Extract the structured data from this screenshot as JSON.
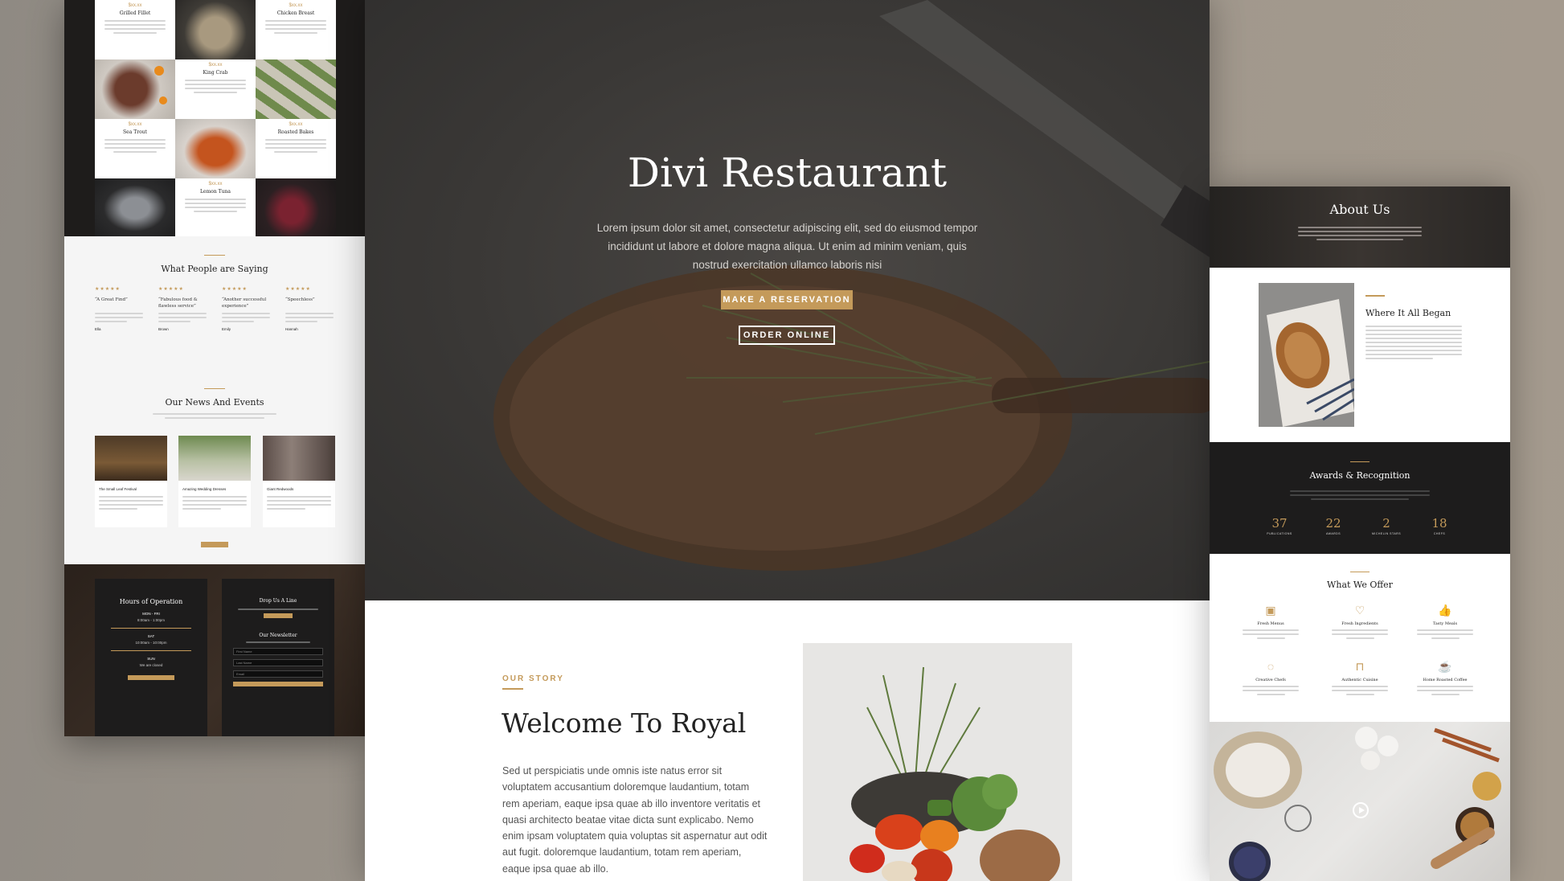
{
  "left_preview": {
    "menu": {
      "items": [
        {
          "price": "$xx.xx",
          "name": "Grilled Fillet"
        },
        {
          "price": "$xx.xx",
          "name": "Chicken Breast"
        },
        {
          "price": "$xx.xx",
          "name": "King Crab"
        },
        {
          "price": "$xx.xx",
          "name": "Sea Trout"
        },
        {
          "price": "$xx.xx",
          "name": "Roasted Bakes"
        },
        {
          "price": "$xx.xx",
          "name": "Lemon Tuna"
        }
      ]
    },
    "testimonials": {
      "title": "What People are Saying",
      "items": [
        {
          "stars": "★★★★★",
          "quote": "“A Great Find”",
          "author": "Ella"
        },
        {
          "stars": "★★★★★",
          "quote": "“Fabulous food & flawless service”",
          "author": "Brown"
        },
        {
          "stars": "★★★★★",
          "quote": "“Another successful experience”",
          "author": "Emily"
        },
        {
          "stars": "★★★★★",
          "quote": "“Speechless”",
          "author": "Hannah"
        }
      ]
    },
    "news": {
      "title": "Our News And Events",
      "items": [
        {
          "title": "The Small Leaf Festival"
        },
        {
          "title": "Amazing Wedding Dresses"
        },
        {
          "title": "Giant Redwoods"
        }
      ]
    },
    "hours": {
      "title": "Hours of Operation",
      "rows": [
        {
          "day": "MON - FRI",
          "time": "8:00am - 1:00pm"
        },
        {
          "day": "SAT",
          "time": "10:00am - 10:00pm"
        },
        {
          "day": "SUN",
          "time": "We are closed"
        }
      ]
    },
    "contact": {
      "title": "Drop Us A Line",
      "newsletter": "Our Newsletter",
      "fields": [
        "First Name",
        "Last Name",
        "Email"
      ]
    }
  },
  "hero": {
    "title": "Divi Restaurant",
    "text": "Lorem ipsum dolor sit amet, consectetur adipiscing elit, sed do eiusmod tempor incididunt ut labore et dolore magna aliqua. Ut enim ad minim veniam, quis nostrud exercitation ullamco laboris nisi",
    "reserve_label": "MAKE A RESERVATION",
    "order_label": "ORDER ONLINE"
  },
  "story": {
    "label": "OUR STORY",
    "title": "Welcome To Royal",
    "text": "Sed ut perspiciatis unde omnis iste natus error sit voluptatem accusantium doloremque laudantium, totam rem aperiam, eaque ipsa quae ab illo inventore veritatis et quasi architecto beatae vitae dicta sunt explicabo. Nemo enim ipsam voluptatem quia voluptas sit aspernatur aut odit aut fugit. doloremque laudantium, totam rem aperiam, eaque ipsa quae ab illo."
  },
  "right_preview": {
    "about_title": "About Us",
    "began_title": "Where It All Began",
    "awards": {
      "title": "Awards & Recognition",
      "stats": [
        {
          "value": "37",
          "label": "PUBLICATIONS"
        },
        {
          "value": "22",
          "label": "AWARDS"
        },
        {
          "value": "2",
          "label": "MICHELIN STARS"
        },
        {
          "value": "18",
          "label": "CHEFS"
        }
      ]
    },
    "offer": {
      "title": "What We Offer",
      "items": [
        {
          "icon": "calendar-icon",
          "glyph": "▣",
          "name": "Fresh Menus"
        },
        {
          "icon": "heart-icon",
          "glyph": "♡",
          "name": "Fresh Ingredients"
        },
        {
          "icon": "thumbs-up-icon",
          "glyph": "👍",
          "name": "Tasty Meals"
        },
        {
          "icon": "lightbulb-icon",
          "glyph": "◌",
          "name": "Creative Chefs"
        },
        {
          "icon": "bookmark-icon",
          "glyph": "⊓",
          "name": "Authentic Cuisine"
        },
        {
          "icon": "coffee-cup-icon",
          "glyph": "☕",
          "name": "Home Roasted Coffee"
        }
      ]
    }
  },
  "colors": {
    "accent": "#c49a5a",
    "dark": "#1d1c1c"
  }
}
